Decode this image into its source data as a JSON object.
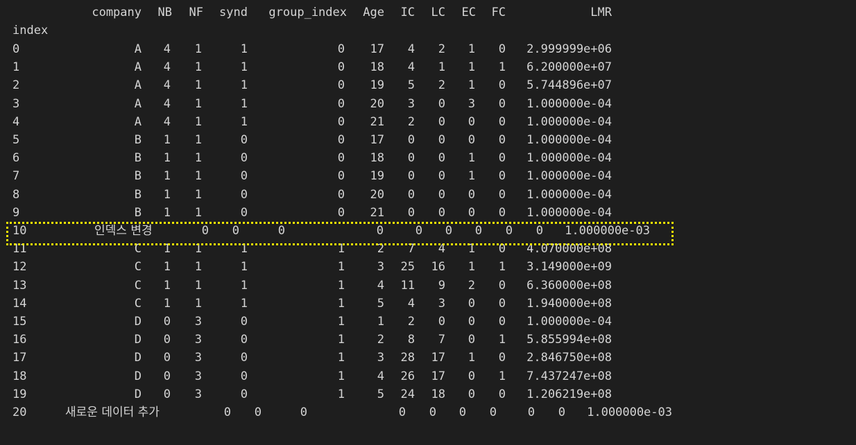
{
  "header": {
    "columns": [
      "company",
      "NB",
      "NF",
      "synd",
      "group_index",
      "Age",
      "IC",
      "LC",
      "EC",
      "FC",
      "LMR"
    ],
    "index_label": "index"
  },
  "rows": [
    {
      "index": "0",
      "company": "A",
      "NB": "4",
      "NF": "1",
      "synd": "1",
      "group_index": "0",
      "Age": "17",
      "IC": "4",
      "LC": "2",
      "EC": "1",
      "FC": "0",
      "LMR": "2.999999e+06"
    },
    {
      "index": "1",
      "company": "A",
      "NB": "4",
      "NF": "1",
      "synd": "1",
      "group_index": "0",
      "Age": "18",
      "IC": "4",
      "LC": "1",
      "EC": "1",
      "FC": "1",
      "LMR": "6.200000e+07"
    },
    {
      "index": "2",
      "company": "A",
      "NB": "4",
      "NF": "1",
      "synd": "1",
      "group_index": "0",
      "Age": "19",
      "IC": "5",
      "LC": "2",
      "EC": "1",
      "FC": "0",
      "LMR": "5.744896e+07"
    },
    {
      "index": "3",
      "company": "A",
      "NB": "4",
      "NF": "1",
      "synd": "1",
      "group_index": "0",
      "Age": "20",
      "IC": "3",
      "LC": "0",
      "EC": "3",
      "FC": "0",
      "LMR": "1.000000e-04"
    },
    {
      "index": "4",
      "company": "A",
      "NB": "4",
      "NF": "1",
      "synd": "1",
      "group_index": "0",
      "Age": "21",
      "IC": "2",
      "LC": "0",
      "EC": "0",
      "FC": "0",
      "LMR": "1.000000e-04"
    },
    {
      "index": "5",
      "company": "B",
      "NB": "1",
      "NF": "1",
      "synd": "0",
      "group_index": "0",
      "Age": "17",
      "IC": "0",
      "LC": "0",
      "EC": "0",
      "FC": "0",
      "LMR": "1.000000e-04"
    },
    {
      "index": "6",
      "company": "B",
      "NB": "1",
      "NF": "1",
      "synd": "0",
      "group_index": "0",
      "Age": "18",
      "IC": "0",
      "LC": "0",
      "EC": "1",
      "FC": "0",
      "LMR": "1.000000e-04"
    },
    {
      "index": "7",
      "company": "B",
      "NB": "1",
      "NF": "1",
      "synd": "0",
      "group_index": "0",
      "Age": "19",
      "IC": "0",
      "LC": "0",
      "EC": "1",
      "FC": "0",
      "LMR": "1.000000e-04"
    },
    {
      "index": "8",
      "company": "B",
      "NB": "1",
      "NF": "1",
      "synd": "0",
      "group_index": "0",
      "Age": "20",
      "IC": "0",
      "LC": "0",
      "EC": "0",
      "FC": "0",
      "LMR": "1.000000e-04"
    },
    {
      "index": "9",
      "company": "B",
      "NB": "1",
      "NF": "1",
      "synd": "0",
      "group_index": "0",
      "Age": "21",
      "IC": "0",
      "LC": "0",
      "EC": "0",
      "FC": "0",
      "LMR": "1.000000e-04"
    },
    {
      "index": "10",
      "company": "인덱스 변경",
      "NB": "0",
      "NF": "0",
      "synd": "0",
      "group_index": "0",
      "Age": "0",
      "IC": "0",
      "LC": "0",
      "EC": "0",
      "FC": "0",
      "LMR": "1.000000e-03",
      "highlighted": true
    },
    {
      "index": "11",
      "company": "C",
      "NB": "1",
      "NF": "1",
      "synd": "1",
      "group_index": "1",
      "Age": "2",
      "IC": "7",
      "LC": "4",
      "EC": "1",
      "FC": "0",
      "LMR": "4.070000e+08"
    },
    {
      "index": "12",
      "company": "C",
      "NB": "1",
      "NF": "1",
      "synd": "1",
      "group_index": "1",
      "Age": "3",
      "IC": "25",
      "LC": "16",
      "EC": "1",
      "FC": "1",
      "LMR": "3.149000e+09"
    },
    {
      "index": "13",
      "company": "C",
      "NB": "1",
      "NF": "1",
      "synd": "1",
      "group_index": "1",
      "Age": "4",
      "IC": "11",
      "LC": "9",
      "EC": "2",
      "FC": "0",
      "LMR": "6.360000e+08"
    },
    {
      "index": "14",
      "company": "C",
      "NB": "1",
      "NF": "1",
      "synd": "1",
      "group_index": "1",
      "Age": "5",
      "IC": "4",
      "LC": "3",
      "EC": "0",
      "FC": "0",
      "LMR": "1.940000e+08"
    },
    {
      "index": "15",
      "company": "D",
      "NB": "0",
      "NF": "3",
      "synd": "0",
      "group_index": "1",
      "Age": "1",
      "IC": "2",
      "LC": "0",
      "EC": "0",
      "FC": "0",
      "LMR": "1.000000e-04"
    },
    {
      "index": "16",
      "company": "D",
      "NB": "0",
      "NF": "3",
      "synd": "0",
      "group_index": "1",
      "Age": "2",
      "IC": "8",
      "LC": "7",
      "EC": "0",
      "FC": "1",
      "LMR": "5.855994e+08"
    },
    {
      "index": "17",
      "company": "D",
      "NB": "0",
      "NF": "3",
      "synd": "0",
      "group_index": "1",
      "Age": "3",
      "IC": "28",
      "LC": "17",
      "EC": "1",
      "FC": "0",
      "LMR": "2.846750e+08"
    },
    {
      "index": "18",
      "company": "D",
      "NB": "0",
      "NF": "3",
      "synd": "0",
      "group_index": "1",
      "Age": "4",
      "IC": "26",
      "LC": "17",
      "EC": "0",
      "FC": "1",
      "LMR": "7.437247e+08"
    },
    {
      "index": "19",
      "company": "D",
      "NB": "0",
      "NF": "3",
      "synd": "0",
      "group_index": "1",
      "Age": "5",
      "IC": "24",
      "LC": "18",
      "EC": "0",
      "FC": "0",
      "LMR": "1.206219e+08"
    },
    {
      "index": "20",
      "company": "새로운 데이터 추가",
      "NB": "0",
      "NF": "0",
      "synd": "0",
      "group_index": "",
      "Age": "0",
      "IC": "0",
      "LC": "0",
      "EC": "0",
      "FC": "0",
      "LMR": "1.000000e-03",
      "extra": "0",
      "appended": true
    }
  ],
  "colors": {
    "background": "#1e1e1e",
    "text": "#d4d4d4",
    "highlight_border": "#f2e600"
  }
}
